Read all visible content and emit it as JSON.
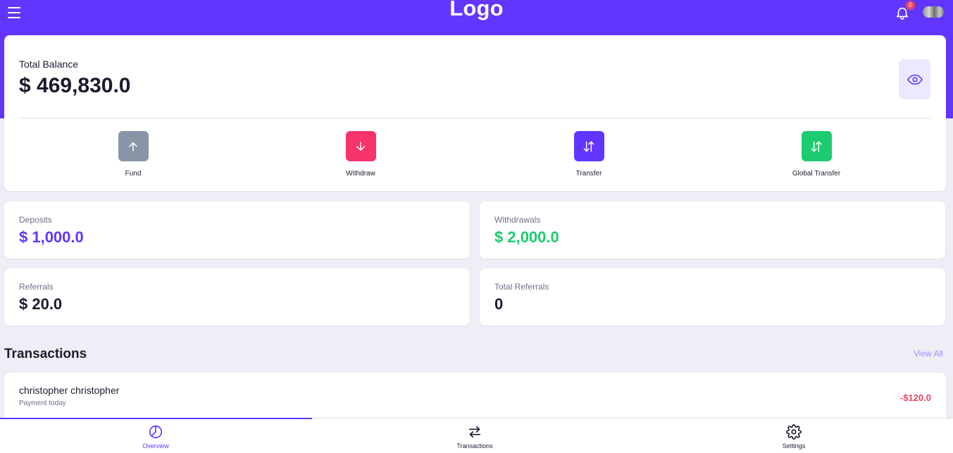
{
  "header": {
    "logo": "Logo",
    "notification_count": "0"
  },
  "balance": {
    "label": "Total Balance",
    "value": "$ 469,830.0"
  },
  "actions": [
    {
      "label": "Fund",
      "color": "#8895a7"
    },
    {
      "label": "Withdraw",
      "color": "#f6336b"
    },
    {
      "label": "Transfer",
      "color": "#6236ff"
    },
    {
      "label": "Global Transfer",
      "color": "#1dcc70"
    }
  ],
  "stats": {
    "deposits": {
      "label": "Deposits",
      "value": "$ 1,000.0",
      "color": "#6236ff"
    },
    "withdrawals": {
      "label": "Withdrawals",
      "value": "$ 2,000.0",
      "color": "#1dcc70"
    },
    "referrals": {
      "label": "Referrals",
      "value": "$ 20.0",
      "color": "#1b1b2f"
    },
    "total_referrals": {
      "label": "Total Referrals",
      "value": "0",
      "color": "#1b1b2f"
    }
  },
  "transactions": {
    "title": "Transactions",
    "view_all": "View All",
    "items": [
      {
        "name": "christopher christopher",
        "sub": "Payment today",
        "amount": "-$120.0"
      }
    ]
  },
  "bottom_nav": [
    {
      "label": "Overview",
      "icon": "pie-chart-icon",
      "active": true
    },
    {
      "label": "Transactions",
      "icon": "swap-icon",
      "active": false
    },
    {
      "label": "Settings",
      "icon": "gear-icon",
      "active": false
    }
  ],
  "colors": {
    "brand": "#6236ff",
    "danger": "#ec4561",
    "success": "#1dcc70"
  }
}
